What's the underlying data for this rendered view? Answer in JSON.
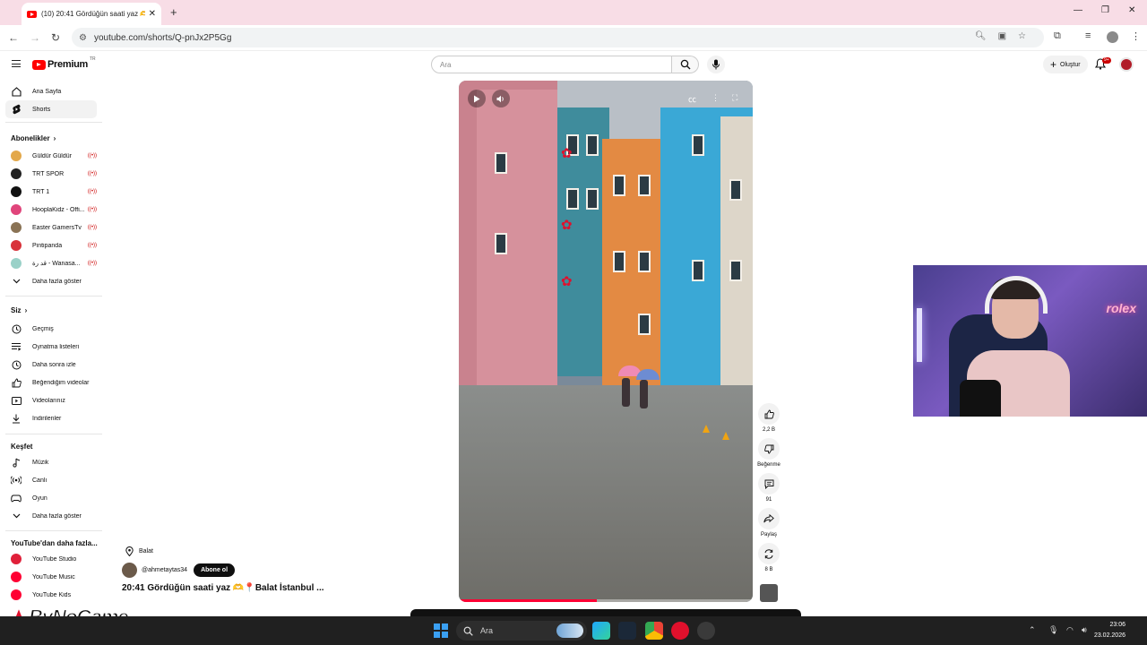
{
  "browser": {
    "tab_title": "(10) 20:41 Gördüğün saati yaz 🫶",
    "tab_close": "✕",
    "new_tab": "+",
    "url": "youtube.com/shorts/Q-pnJx2P5Gg",
    "window_controls": {
      "minimize": "—",
      "restore": "❐",
      "close": "✕"
    }
  },
  "masthead": {
    "logo_text": "Premium",
    "logo_country": "TR",
    "search_placeholder": "Ara",
    "create_label": "Oluştur",
    "notifications_badge": "9+"
  },
  "sidebar": {
    "main": [
      {
        "label": "Ana Sayfa",
        "icon": "home-icon"
      },
      {
        "label": "Shorts",
        "icon": "shorts-icon",
        "active": true
      }
    ],
    "subscriptions_header": "Abonelikler",
    "subscriptions": [
      {
        "label": "Güldür Güldür",
        "color": "#e3a84a",
        "live": true
      },
      {
        "label": "TRT SPOR",
        "color": "#222222",
        "live": true
      },
      {
        "label": "TRT 1",
        "color": "#111111",
        "live": true
      },
      {
        "label": "HooplaKidz - Offi...",
        "color": "#e0457b",
        "live": true
      },
      {
        "label": "Easter GamersTv",
        "color": "#8a7355",
        "live": true
      },
      {
        "label": "Pintipanda",
        "color": "#d8323a",
        "live": true
      },
      {
        "label": "ﻗﺪ ﺭﺓ - Wanasa...",
        "color": "#9ad1c8",
        "live": true
      }
    ],
    "show_more": "Daha fazla göster",
    "you_header": "Siz",
    "you": [
      {
        "label": "Geçmiş",
        "icon": "history-icon"
      },
      {
        "label": "Oynatma listeleri",
        "icon": "playlists-icon"
      },
      {
        "label": "Daha sonra izle",
        "icon": "watch-later-icon"
      },
      {
        "label": "Beğendiğim videolar",
        "icon": "liked-icon"
      },
      {
        "label": "Videolarınız",
        "icon": "your-videos-icon"
      },
      {
        "label": "İndirilenler",
        "icon": "downloads-icon"
      }
    ],
    "explore_header": "Keşfet",
    "explore": [
      {
        "label": "Müzik",
        "icon": "music-icon"
      },
      {
        "label": "Canlı",
        "icon": "live-icon"
      },
      {
        "label": "Oyun",
        "icon": "gaming-icon"
      }
    ],
    "explore_more": "Daha fazla göster",
    "more_header": "YouTube'dan daha fazla...",
    "more": [
      {
        "label": "YouTube Studio"
      },
      {
        "label": "YouTube Music"
      },
      {
        "label": "YouTube Kids"
      }
    ]
  },
  "short": {
    "location": "Balat",
    "channel": "@ahmetaytas34",
    "subscribe_label": "Abone ol",
    "title": "20:41 Gördüğün saati yaz 🫶📍Balat İstanbul ...",
    "progress": 0.47
  },
  "actions": {
    "likes": "2,2 B",
    "dislike_label": "Beğenme",
    "comments": "91",
    "share_label": "Paylaş",
    "remix_count": "8 B"
  },
  "webcam": {
    "neon_text": "rolex"
  },
  "watermark": "ByNoGame",
  "taskbar": {
    "search_placeholder": "Ara",
    "time": "23:06",
    "date": "23.02.2026"
  }
}
